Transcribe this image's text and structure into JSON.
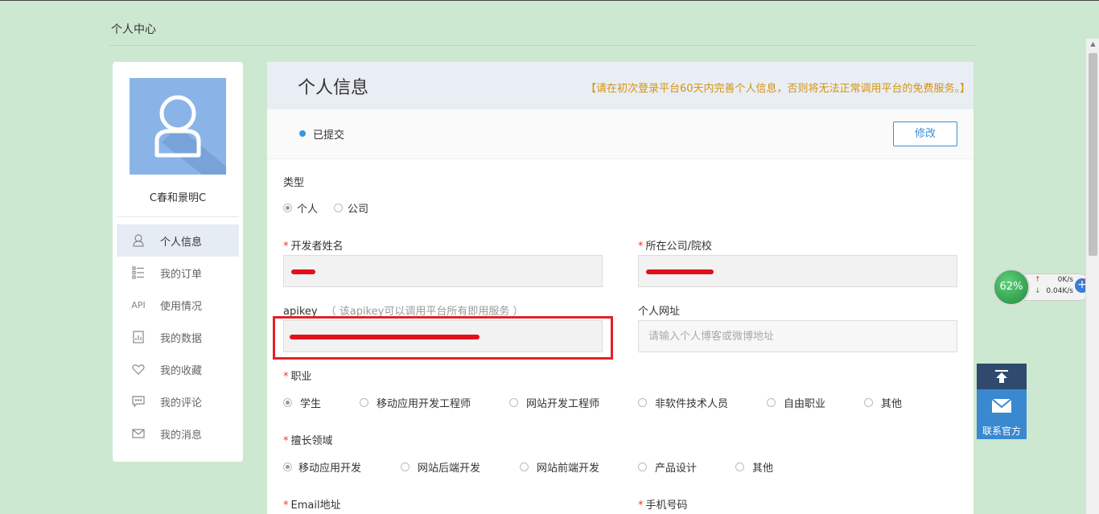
{
  "breadcrumb": "个人中心",
  "user": {
    "name": "C春和景明C"
  },
  "sidebar": {
    "items": [
      {
        "label": "个人信息",
        "icon": "user-icon",
        "active": true
      },
      {
        "label": "我的订单",
        "icon": "list-icon",
        "active": false
      },
      {
        "label": "使用情况",
        "icon": "api-icon",
        "icon_text": "API",
        "active": false
      },
      {
        "label": "我的数据",
        "icon": "data-icon",
        "active": false
      },
      {
        "label": "我的收藏",
        "icon": "heart-icon",
        "active": false
      },
      {
        "label": "我的评论",
        "icon": "comment-icon",
        "active": false
      },
      {
        "label": "我的消息",
        "icon": "mail-icon",
        "active": false
      }
    ]
  },
  "panel": {
    "title": "个人信息",
    "notice": "【请在初次登录平台60天内完善个人信息，否则将无法正常调用平台的免费服务。】",
    "status": "已提交",
    "edit_label": "修改"
  },
  "form": {
    "type": {
      "label": "类型",
      "options": [
        "个人",
        "公司"
      ],
      "selected": "个人"
    },
    "developer_name": {
      "label": "开发者姓名",
      "required": true
    },
    "company": {
      "label": "所在公司/院校",
      "required": true
    },
    "apikey": {
      "label": "apikey",
      "hint": "（ 该apikey可以调用平台所有即用服务 ）"
    },
    "website": {
      "label": "个人网址",
      "placeholder": "请输入个人博客或微博地址"
    },
    "occupation": {
      "label": "职业",
      "required": true,
      "options": [
        "学生",
        "移动应用开发工程师",
        "网站开发工程师",
        "非软件技术人员",
        "自由职业",
        "其他"
      ],
      "selected": "学生"
    },
    "expertise": {
      "label": "擅长领域",
      "required": true,
      "options": [
        "移动应用开发",
        "网站后端开发",
        "网站前端开发",
        "产品设计",
        "其他"
      ],
      "selected": "移动应用开发"
    },
    "email": {
      "label": "Email地址",
      "required": true
    },
    "phone": {
      "label": "手机号码",
      "required": true
    },
    "required_mark": "*"
  },
  "widgets": {
    "net_percent": "62%",
    "upload": "0K/s",
    "download": "0.04K/s",
    "contact_label": "联系官方"
  },
  "colors": {
    "background": "#cde8d1",
    "accent": "#3c8fd6",
    "notice": "#d9920e",
    "highlight": "#e32129"
  }
}
